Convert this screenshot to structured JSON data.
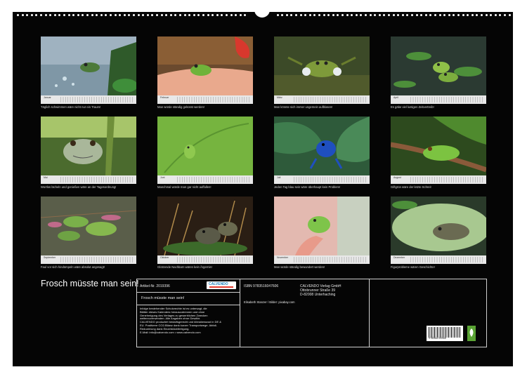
{
  "calendar": {
    "title": "Frosch müsste man sein!",
    "months": [
      {
        "month": "Januar",
        "caption": "Täglich schwimmen wäre nicht nur ein Traum!",
        "icon": "frog-in-water-photo"
      },
      {
        "month": "Februar",
        "caption": "Man würde ständig geküsst werden!",
        "icon": "frog-on-hand-photo"
      },
      {
        "month": "März",
        "caption": "Man könnte sich immer ungemein aufblasen!",
        "icon": "croaking-frog-photo"
      },
      {
        "month": "April",
        "caption": "Es gäbe viel lustigen Zeitvertreib!",
        "icon": "frogs-on-lilypads-photo"
      },
      {
        "month": "Mai",
        "caption": "Wortlos lächeln und genießen wäre an der Tagesordnung!",
        "icon": "smiling-treefrog-photo"
      },
      {
        "month": "Juni",
        "caption": "Manchmal würde man gar nicht auffallen!",
        "icon": "frog-on-leaf-photo"
      },
      {
        "month": "Juli",
        "caption": "Jeden Tag blau sein wäre überhaupt kein Problem!",
        "icon": "blue-dart-frog-photo"
      },
      {
        "month": "August",
        "caption": "Giftgrün wäre der letzte Schrei!",
        "icon": "frog-on-branch-photo"
      },
      {
        "month": "September",
        "caption": "Faul vor sich hindümpeln wäre absolut angesagt!",
        "icon": "frogs-in-pond-photo"
      },
      {
        "month": "Oktober",
        "caption": "Glotzende Nachbarn wären kein Ärgernis!",
        "icon": "frogs-in-grass-photo"
      },
      {
        "month": "November",
        "caption": "Man würde ständig bewundert werden!",
        "icon": "frog-on-finger-photo"
      },
      {
        "month": "Dezember",
        "caption": "Figurprobleme wären Geschichte!",
        "icon": "frog-on-lilypad-photo"
      }
    ]
  },
  "back_panel": {
    "article_label": "Artikel-Nr. 2019396",
    "logo_text": "CALVENDO",
    "panel_title": "Frosch müsste man sein!",
    "isbn": "ISBN 9783516047606",
    "publisher": [
      "CALVENDO Verlag GmbH",
      "Ottobrunner Straße 39",
      "D-82008 Unterhaching"
    ],
    "credit": "Elisabeth Stanzer / Bilder: pixabay.com",
    "fine_print": [
      "Infolge bestehender Schutzrechte ist es untersagt, die",
      "Blätter dieses Kalenders herauszutrennen und ohne",
      "Genehmigung des Verlages zu gewerblichen Zwecken",
      "weiterzuverwenden. Alle Angaben ohne Gewähr.",
      "CALVENDO produziert bedarfsgerecht und klimabewusst in DE &",
      "EU. Positivere CO2-Bilanz dank kurzer Transportwege. Abfall-",
      "Reduzierung dank Einzelstückfertigung.",
      "E-Mail: info@calvendo.com • www.calvendo.com"
    ],
    "barcode_number": "9 783516 047606",
    "colors": {
      "logo_blue": "#1c7fb9",
      "logo_red": "#e53c2e",
      "eco_green": "#5aa334"
    }
  }
}
